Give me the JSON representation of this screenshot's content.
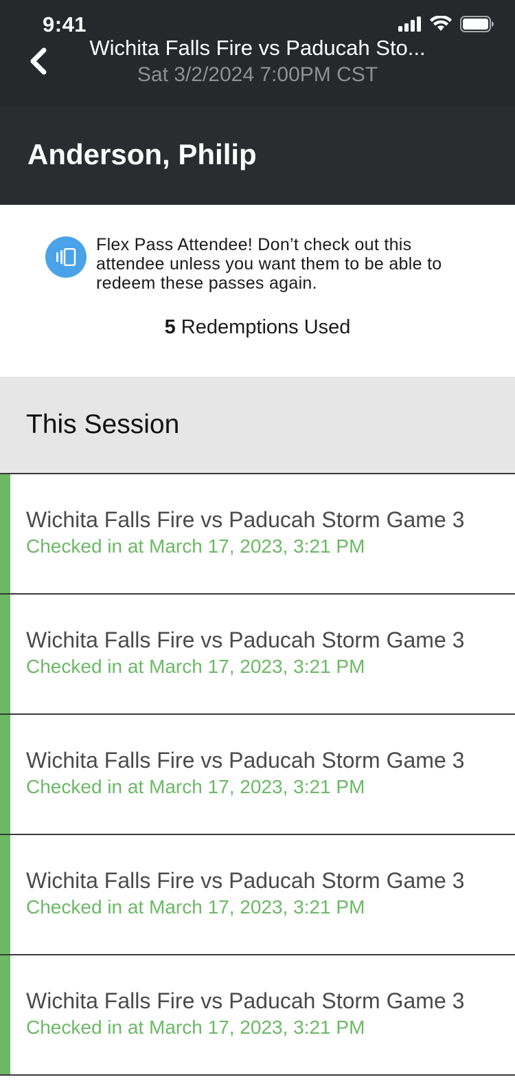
{
  "status_bar": {
    "time": "9:41",
    "icons": [
      "signal-icon",
      "wifi-icon",
      "battery-icon"
    ]
  },
  "nav": {
    "back_icon": "chevron-left-icon",
    "title": "Wichita Falls Fire vs Paducah Sto...",
    "subtitle": "Sat 3/2/2024 7:00PM CST"
  },
  "attendee": {
    "name": "Anderson, Philip"
  },
  "notice": {
    "icon": "flex-pass-icon",
    "text": "Flex Pass Attendee! Don’t check out this attendee unless you want them to be able to redeem these passes again.",
    "redemptions_count": "5",
    "redemptions_label": "Redemptions Used"
  },
  "section": {
    "title": "This Session"
  },
  "sessions": [
    {
      "title": "Wichita Falls Fire vs Paducah Storm Game 3",
      "status": "Checked in at March 17, 2023, 3:21 PM"
    },
    {
      "title": "Wichita Falls Fire vs Paducah Storm Game 3",
      "status": "Checked in at March 17, 2023, 3:21 PM"
    },
    {
      "title": "Wichita Falls Fire vs Paducah Storm Game 3",
      "status": "Checked in at March 17, 2023, 3:21 PM"
    },
    {
      "title": "Wichita Falls Fire vs Paducah Storm Game 3",
      "status": "Checked in at March 17, 2023, 3:21 PM"
    },
    {
      "title": "Wichita Falls Fire vs Paducah Storm Game 3",
      "status": "Checked in at March 17, 2023, 3:21 PM"
    }
  ],
  "colors": {
    "header_bg": "#26282c",
    "accent_green": "#6cb865",
    "info_blue": "#4aa3e8",
    "section_bg": "#e6e6e6"
  }
}
